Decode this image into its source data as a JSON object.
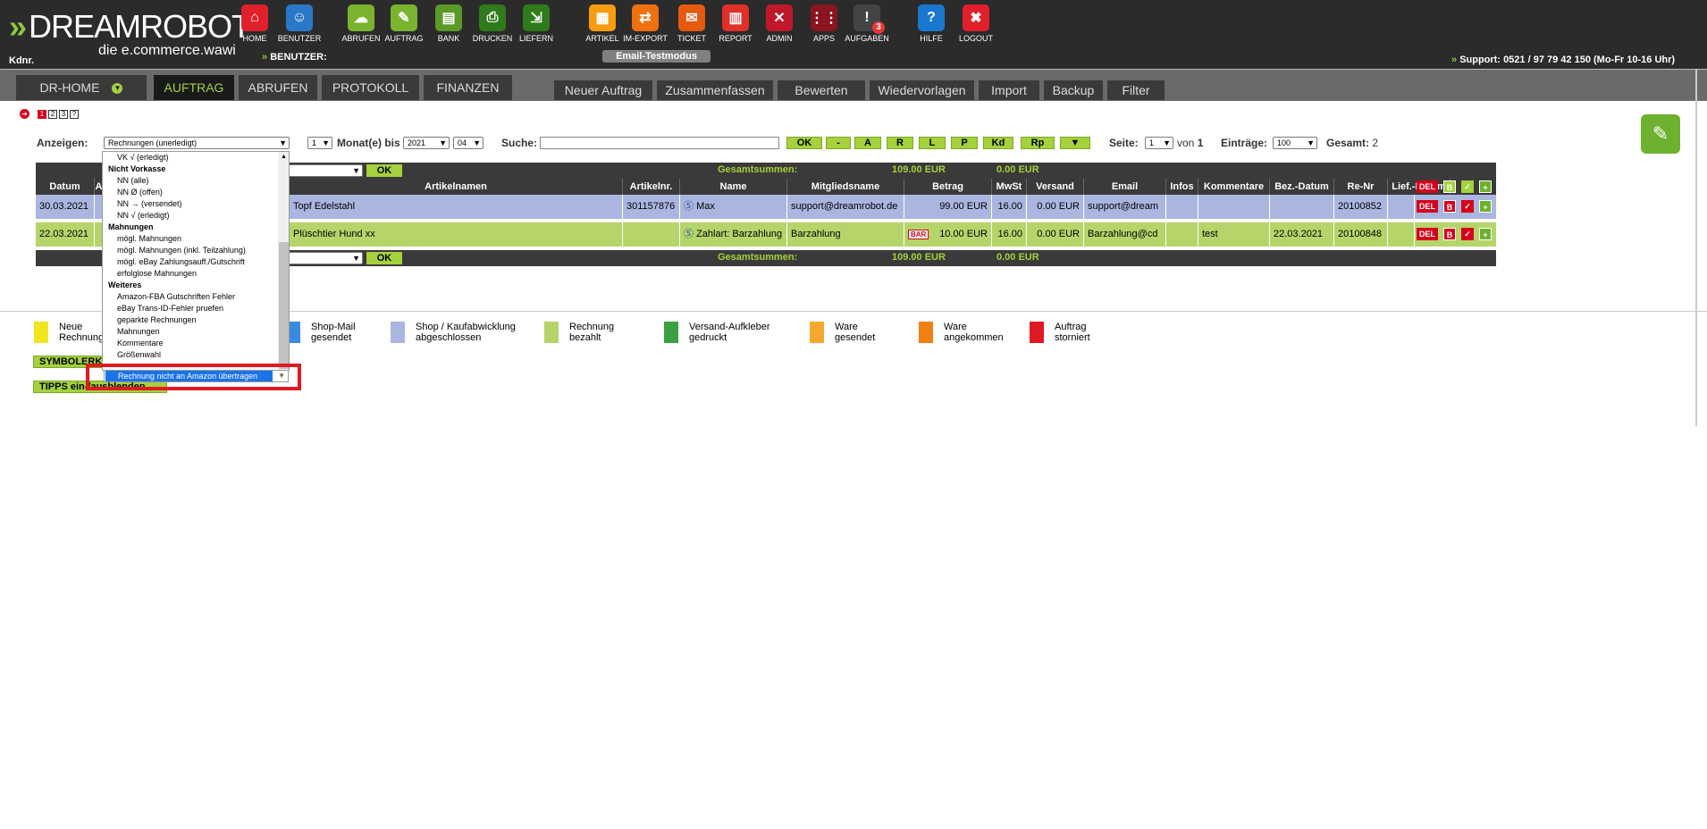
{
  "header": {
    "logo_big": "DREAMROBOT",
    "logo_sub": "die e.commerce.wawi",
    "kdnr": "Kdnr.",
    "benutzer": "BENUTZER:",
    "email_mode": "Email-Testmodus",
    "support": "Support: 0521 / 97 79 42 150 (Mo-Fr 10-16 Uhr)",
    "nav": [
      {
        "label": "HOME",
        "icon": "home-icon",
        "color": "#e0202a"
      },
      {
        "label": "BENUTZER",
        "icon": "user-icon",
        "color": "#2a78c8"
      },
      {
        "label": "ABRUFEN",
        "icon": "download-cloud-icon",
        "color": "#7ab32e"
      },
      {
        "label": "AUFTRAG",
        "icon": "order-icon",
        "color": "#7ab32e"
      },
      {
        "label": "BANK",
        "icon": "bank-icon",
        "color": "#5a9a28"
      },
      {
        "label": "DRUCKEN",
        "icon": "printer-icon",
        "color": "#2f7a1a"
      },
      {
        "label": "LIEFERN",
        "icon": "cart-icon",
        "color": "#2f7a1a"
      },
      {
        "label": "ARTIKEL",
        "icon": "box-icon",
        "color": "#f59c10"
      },
      {
        "label": "IM-EXPORT",
        "icon": "exchange-icon",
        "color": "#f07010"
      },
      {
        "label": "TICKET",
        "icon": "mail-icon",
        "color": "#e65a10"
      },
      {
        "label": "REPORT",
        "icon": "chart-icon",
        "color": "#e0302a"
      },
      {
        "label": "ADMIN",
        "icon": "tools-icon",
        "color": "#c0182a"
      },
      {
        "label": "APPS",
        "icon": "apps-grid-icon",
        "color": "#8a1420"
      },
      {
        "label": "AUFGABEN",
        "icon": "tasks-icon",
        "color": "#444444",
        "badge": "3"
      },
      {
        "label": "HILFE",
        "icon": "help-icon",
        "color": "#1a78d0"
      },
      {
        "label": "LOGOUT",
        "icon": "logout-icon",
        "color": "#e0202a"
      }
    ]
  },
  "main_tabs": [
    {
      "label": "DR-HOME"
    },
    {
      "label": "AUFTRAG"
    },
    {
      "label": "ABRUFEN"
    },
    {
      "label": "PROTOKOLL"
    },
    {
      "label": "FINANZEN"
    }
  ],
  "sub_tabs": [
    "Neuer Auftrag",
    "Zusammenfassen",
    "Bewerten",
    "Wiedervorlagen",
    "Import",
    "Backup",
    "Filter"
  ],
  "pages": [
    "1",
    "2",
    "3",
    "?"
  ],
  "filter": {
    "anzeigen_label": "Anzeigen:",
    "anzeigen_value": "Rechnungen (unerledigt)",
    "months_value": "1",
    "months_label": "Monat(e) bis",
    "year": "2021",
    "month": "04",
    "suche_label": "Suche:",
    "suche_value": "",
    "buttons": [
      "OK",
      "-",
      "A",
      "R",
      "L",
      "P",
      "Kd",
      "Rp"
    ],
    "seite_label": "Seite:",
    "seite_value": "1",
    "von": "von",
    "von_total": "1",
    "eintraege_label": "Einträge:",
    "eintraege_value": "100",
    "gesamt_label": "Gesamt:",
    "gesamt_value": "2"
  },
  "table": {
    "sum_label": "Gesamtsummen:",
    "sum_betrag": "109.00 EUR",
    "sum_versand": "0.00 EUR",
    "ok_label": "OK",
    "columns": [
      "Datum",
      "A",
      "",
      "Artikelnamen",
      "Artikelnr.",
      "Name",
      "Mitgliedsname",
      "Betrag",
      "MwSt",
      "Versand",
      "Email",
      "Infos",
      "Kommentare",
      "Bez.-Datum",
      "Re-Nr",
      "Lief.-Datum"
    ],
    "header_icons": {
      "del": "DEL",
      "b": "B"
    },
    "rows": [
      {
        "datum": "30.03.2021",
        "artikel": "Topf Edelstahl",
        "artikelnr": "301157876",
        "name": "Max",
        "mitglied": "support@dreamrobot.de",
        "bar": "",
        "betrag": "99.00 EUR",
        "mwst": "16.00",
        "versand": "0.00 EUR",
        "email": "support@dream",
        "infos": "",
        "kommentare": "",
        "bezdatum": "",
        "renr": "20100852",
        "liefdatum": "",
        "color": "#aab6e0"
      },
      {
        "datum": "22.03.2021",
        "artikel": "Plüschtier Hund xx",
        "artikelnr": "",
        "name": "Zahlart: Barzahlung",
        "mitglied": "Barzahlung",
        "bar": "BAR",
        "betrag": "10.00 EUR",
        "mwst": "16.00",
        "versand": "0.00 EUR",
        "email": "Barzahlung@cd",
        "infos": "",
        "kommentare": "test",
        "bezdatum": "22.03.2021",
        "renr": "20100848",
        "liefdatum": "",
        "color": "#b5d56a"
      }
    ]
  },
  "legend": [
    {
      "text1": "Neue",
      "text2": "Rechnung",
      "color": "#f0e61e"
    },
    {
      "text1": "Shop-Mail",
      "text2": "gesendet",
      "color": "#3a8ae0"
    },
    {
      "text1": "Shop / Kaufabwicklung",
      "text2": "abgeschlossen",
      "color": "#aab6e0"
    },
    {
      "text1": "Rechnung",
      "text2": "bezahlt",
      "color": "#b5d56a"
    },
    {
      "text1": "Versand-Aufkleber",
      "text2": "gedruckt",
      "color": "#3aa040"
    },
    {
      "text1": "Ware",
      "text2": "gesendet",
      "color": "#f5a830"
    },
    {
      "text1": "Ware",
      "text2": "angekommen",
      "color": "#f08010"
    },
    {
      "text1": "Auftrag",
      "text2": "storniert",
      "color": "#e01a22"
    }
  ],
  "toggles": {
    "symbol": "SYMBOLERKLÄRUNG",
    "tipps": "TIPPS ein-/ausblenden"
  },
  "dropdown": {
    "options": [
      {
        "text": "VK √    (erledigt)",
        "group": false
      },
      {
        "text": "Nicht Vorkasse",
        "group": true
      },
      {
        "text": "NN        (alle)",
        "group": false
      },
      {
        "text": "NN Ø    (offen)",
        "group": false
      },
      {
        "text": "NN →  (versendet)",
        "group": false
      },
      {
        "text": "NN √    (erledigt)",
        "group": false
      },
      {
        "text": "Mahnungen",
        "group": true
      },
      {
        "text": "mögl. Mahnungen",
        "group": false
      },
      {
        "text": "mögl. Mahnungen (inkl. Teilzahlung)",
        "group": false
      },
      {
        "text": "mögl. eBay Zahlungsauff./Gutschrift",
        "group": false
      },
      {
        "text": "erfolglose Mahnungen",
        "group": false
      },
      {
        "text": "Weiteres",
        "group": true
      },
      {
        "text": "Amazon-FBA Gutschriften Fehler",
        "group": false
      },
      {
        "text": "eBay Trans-ID-Fehler pruefen",
        "group": false
      },
      {
        "text": "geparkte Rechnungen",
        "group": false
      },
      {
        "text": "Mahnungen",
        "group": false
      },
      {
        "text": "Kommentare",
        "group": false
      },
      {
        "text": "Größenwahl",
        "group": false
      }
    ],
    "selected": "Rechnung nicht an Amazon übertragen"
  }
}
